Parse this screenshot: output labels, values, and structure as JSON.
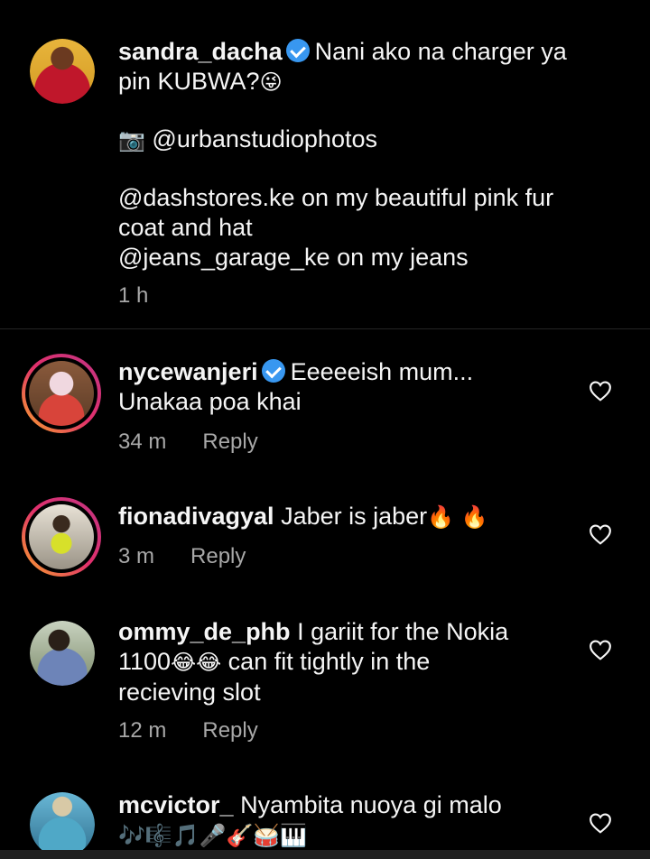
{
  "caption": {
    "username": "sandra_dacha",
    "verified": true,
    "line1": "Nani ako na charger ya",
    "line2": "pin KUBWA?",
    "emoji_wink": "😜",
    "camera_emoji": "📷",
    "credit": "@urbanstudiophotos",
    "line3": "@dashstores.ke on my beautiful pink fur",
    "line4": "coat and hat",
    "line5": "@jeans_garage_ke on my jeans",
    "time": "1 h"
  },
  "comments": [
    {
      "username": "nycewanjeri",
      "verified": true,
      "text1": "Eeeeeish mum...",
      "text2": "Unakaa poa khai",
      "time": "34 m",
      "reply": "Reply"
    },
    {
      "username": "fionadivagyal",
      "text1": "Jaber is jaber",
      "emoji": "🔥 🔥",
      "time": "3 m",
      "reply": "Reply"
    },
    {
      "username": "ommy_de_phb",
      "text1": "I gariit for the Nokia",
      "text2a": "1100",
      "emoji": "😂😂",
      "text2b": "can fit tightly in the",
      "text3": "recieving slot",
      "time": "12 m",
      "reply": "Reply"
    },
    {
      "username": "mcvictor_",
      "text1": "Nyambita nuoya gi malo",
      "emoji_row": "🎶🎼🎵🎤🎸🥁🎹"
    }
  ],
  "icons": {
    "verified": "verified-badge-icon",
    "like": "heart-outline-icon"
  },
  "colors": {
    "background": "#000000",
    "text": "#f5f5f5",
    "meta": "#a8a8a8",
    "verified": "#3897f0"
  }
}
